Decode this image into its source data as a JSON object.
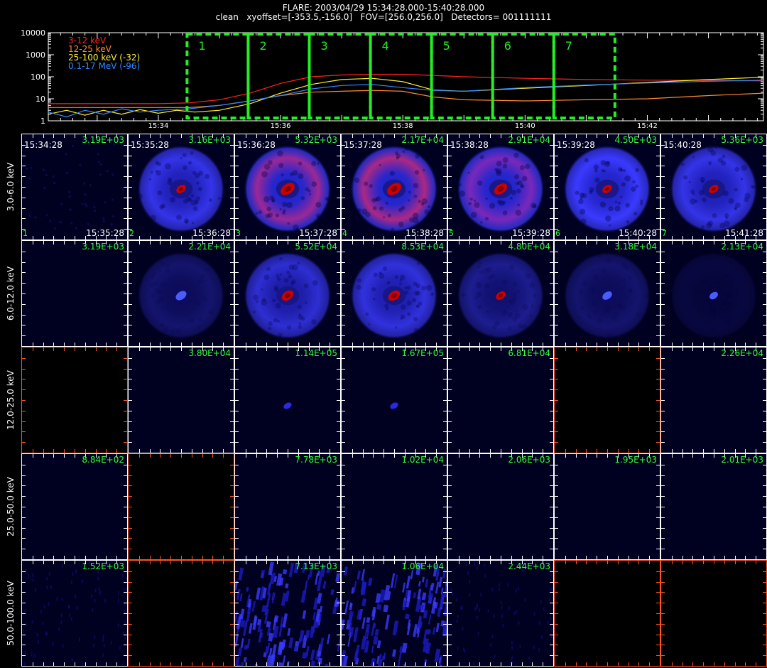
{
  "header": {
    "line1": "FLARE: 2003/04/29 15:34:28.000-15:40:28.000",
    "line2": "clean   xyoffset=[-353.5,-156.0]   FOV=[256.0,256.0]   Detectors= 001111111"
  },
  "colors": {
    "band_3_12": "#ff2222",
    "band_12_25": "#ff8833",
    "band_25_100": "#ffee33",
    "band_01_17": "#3388ff",
    "interval_box": "#22ee22",
    "peak_text": "#33ff33",
    "empty_frame": "#ff5522"
  },
  "chart_data": {
    "type": "line",
    "yscale": "log",
    "ylim": [
      1,
      10000
    ],
    "y_tick_labels": [
      "1",
      "10",
      "100",
      "1000",
      "10000"
    ],
    "x_tick_labels": [
      "15:34",
      "15:36",
      "15:38",
      "15:40",
      "15:42"
    ],
    "x_ticks_min": [
      34,
      36,
      38,
      40,
      42
    ],
    "xlim_min": [
      32.2,
      43.9
    ],
    "legend": [
      {
        "label": "3-12 keV",
        "color": "#ff2222"
      },
      {
        "label": "12-25 keV",
        "color": "#ff8833"
      },
      {
        "label": "25-100 keV (-32)",
        "color": "#ffee33"
      },
      {
        "label": "0.1-17 MeV (-96)",
        "color": "#3388ff"
      }
    ],
    "intervals": [
      {
        "label": "1",
        "start": 34.47,
        "end": 35.47
      },
      {
        "label": "2",
        "start": 35.47,
        "end": 36.47
      },
      {
        "label": "3",
        "start": 36.47,
        "end": 37.47
      },
      {
        "label": "4",
        "start": 37.47,
        "end": 38.47
      },
      {
        "label": "5",
        "start": 38.47,
        "end": 39.47
      },
      {
        "label": "6",
        "start": 39.47,
        "end": 40.47
      },
      {
        "label": "7",
        "start": 40.47,
        "end": 41.47
      }
    ],
    "series": [
      {
        "color": "#ff2222",
        "x": [
          32.2,
          33.0,
          34.0,
          34.5,
          35.0,
          35.5,
          36.0,
          36.5,
          37.0,
          37.5,
          38.0,
          38.5,
          39.0,
          40.0,
          41.0,
          42.0,
          43.0,
          43.9
        ],
        "y": [
          6,
          6,
          6,
          6.5,
          9,
          18,
          50,
          100,
          120,
          130,
          130,
          115,
          100,
          85,
          75,
          70,
          68,
          65
        ]
      },
      {
        "color": "#ff8833",
        "x": [
          32.2,
          33.0,
          34.0,
          34.5,
          35.0,
          35.5,
          36.0,
          36.5,
          37.0,
          37.5,
          38.0,
          38.5,
          39.0,
          40.0,
          41.0,
          42.0,
          43.0,
          43.9
        ],
        "y": [
          4,
          4,
          4,
          4,
          5,
          8,
          14,
          20,
          22,
          24,
          22,
          12,
          9,
          8,
          9,
          10,
          14,
          18
        ]
      },
      {
        "color": "#ffee33",
        "x": [
          32.2,
          32.5,
          32.8,
          33.1,
          33.4,
          33.7,
          34.0,
          34.3,
          34.6,
          35.0,
          35.5,
          36.0,
          36.5,
          37.0,
          37.5,
          38.0,
          38.5,
          39.0,
          40.0,
          41.0,
          42.0,
          43.0,
          43.9
        ],
        "y": [
          2,
          3,
          1.8,
          3,
          2,
          3.2,
          2.2,
          3,
          2.5,
          3,
          6,
          18,
          45,
          75,
          85,
          60,
          25,
          22,
          30,
          40,
          55,
          75,
          95
        ]
      },
      {
        "color": "#3388ff",
        "x": [
          32.2,
          32.5,
          32.8,
          33.1,
          33.4,
          33.7,
          34.0,
          34.5,
          35.0,
          35.5,
          36.0,
          36.5,
          37.0,
          37.5,
          38.0,
          38.5,
          39.0,
          40.0,
          41.0,
          42.0,
          43.0,
          43.9
        ],
        "y": [
          2.5,
          1.5,
          3,
          2,
          3.5,
          2.5,
          3,
          3.5,
          5,
          8,
          14,
          28,
          40,
          45,
          32,
          24,
          22,
          32,
          42,
          52,
          62,
          70
        ]
      }
    ]
  },
  "image_grid": {
    "row_labels": [
      "3.0-6.0 keV",
      "6.0-12.0 keV",
      "12.0-25.0 keV",
      "25.0-50.0 keV",
      "50.0-100.0 keV"
    ],
    "time_starts": [
      "15:34:28",
      "15:35:28",
      "15:36:28",
      "15:37:28",
      "15:38:28",
      "15:39:28",
      "15:40:28"
    ],
    "time_ends": [
      "15:35:28",
      "15:36:28",
      "15:37:28",
      "15:38:28",
      "15:39:28",
      "15:40:28",
      "15:41:28"
    ],
    "column_numbers": [
      "1",
      "2",
      "3",
      "4",
      "5",
      "6",
      "7"
    ],
    "rows": [
      [
        {
          "peak": "3.19E+03",
          "kind": "noise"
        },
        {
          "peak": "3.16E+03",
          "kind": "disk",
          "ring": 0.9,
          "core": 0.6
        },
        {
          "peak": "5.32E+03",
          "kind": "disk",
          "ring": 1.0,
          "core": 1.0,
          "red": 0.6
        },
        {
          "peak": "2.17E+04",
          "kind": "disk",
          "ring": 1.0,
          "core": 1.0,
          "red": 0.75
        },
        {
          "peak": "2.91E+04",
          "kind": "disk",
          "ring": 1.0,
          "core": 0.9,
          "red": 0.3
        },
        {
          "peak": "4.50E+03",
          "kind": "disk",
          "ring": 1.0,
          "core": 0.6
        },
        {
          "peak": "5.36E+03",
          "kind": "disk",
          "ring": 0.9,
          "core": 0.6
        }
      ],
      [
        {
          "peak": "3.19E+03",
          "kind": "blank"
        },
        {
          "peak": "2.21E+04",
          "kind": "disk",
          "ring": 0.35,
          "core": 0.7,
          "corecolor": "blue"
        },
        {
          "peak": "5.52E+04",
          "kind": "disk",
          "ring": 0.8,
          "core": 0.8
        },
        {
          "peak": "8.53E+04",
          "kind": "disk",
          "ring": 0.85,
          "core": 0.8
        },
        {
          "peak": "4.80E+04",
          "kind": "disk",
          "ring": 0.5,
          "core": 0.6
        },
        {
          "peak": "3.18E+04",
          "kind": "disk",
          "ring": 0.35,
          "core": 0.6,
          "corecolor": "blue"
        },
        {
          "peak": "2.13E+04",
          "kind": "disk",
          "ring": 0.15,
          "core": 0.5,
          "corecolor": "blue"
        }
      ],
      [
        {
          "peak": "",
          "kind": "empty"
        },
        {
          "peak": "3.80E+04",
          "kind": "blank"
        },
        {
          "peak": "1.14E+05",
          "kind": "dot"
        },
        {
          "peak": "1.67E+05",
          "kind": "dot"
        },
        {
          "peak": "6.81E+04",
          "kind": "blank"
        },
        {
          "peak": "",
          "kind": "empty"
        },
        {
          "peak": "2.26E+04",
          "kind": "blank"
        }
      ],
      [
        {
          "peak": "8.84E+02",
          "kind": "blank"
        },
        {
          "peak": "",
          "kind": "empty"
        },
        {
          "peak": "7.78E+03",
          "kind": "blank"
        },
        {
          "peak": "1.02E+04",
          "kind": "blank"
        },
        {
          "peak": "2.06E+03",
          "kind": "blank"
        },
        {
          "peak": "1.95E+03",
          "kind": "blank"
        },
        {
          "peak": "2.01E+03",
          "kind": "blank"
        }
      ],
      [
        {
          "peak": "1.52E+03",
          "kind": "faint"
        },
        {
          "peak": "",
          "kind": "empty"
        },
        {
          "peak": "7.13E+03",
          "kind": "streak"
        },
        {
          "peak": "1.06E+04",
          "kind": "streak"
        },
        {
          "peak": "2.44E+03",
          "kind": "faint"
        },
        {
          "peak": "",
          "kind": "empty"
        },
        {
          "peak": "",
          "kind": "empty"
        }
      ]
    ]
  }
}
